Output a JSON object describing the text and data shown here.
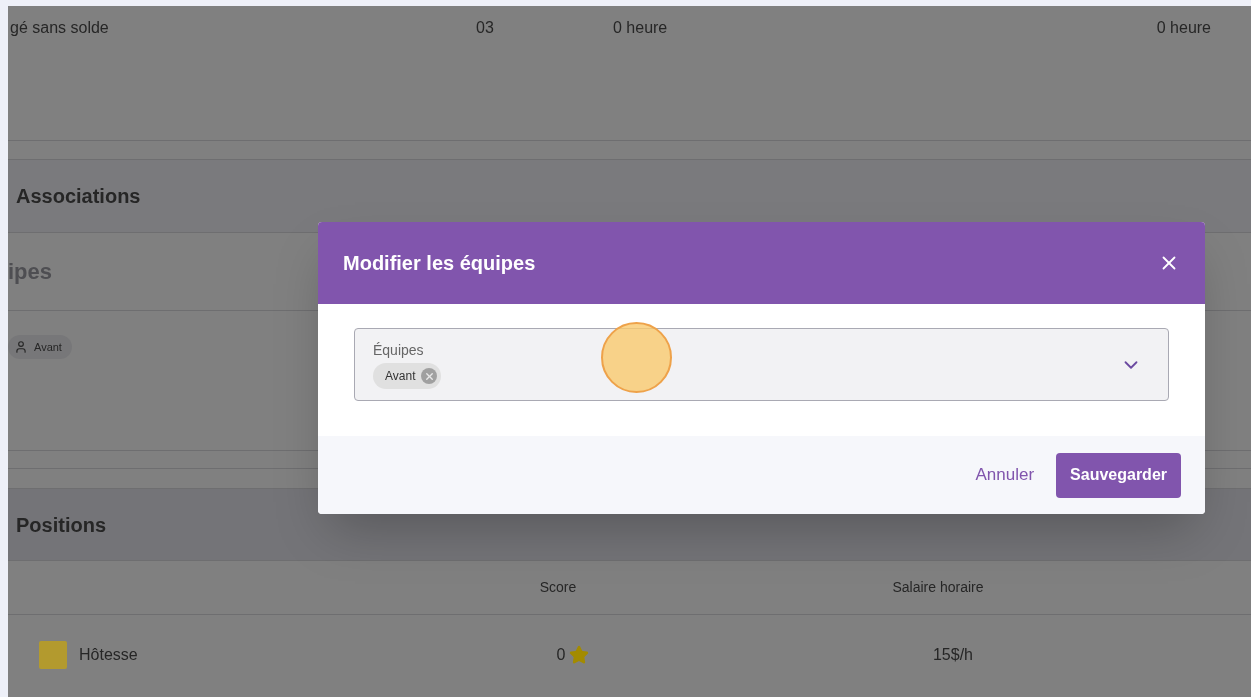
{
  "leave_row": {
    "type": "gé sans solde",
    "code": "03",
    "hours": "0 heure",
    "balance": "0 heure"
  },
  "associations": {
    "title": "Associations",
    "teams_title": "ipes",
    "teams": [
      {
        "label": "Avant"
      }
    ]
  },
  "positions": {
    "title": "Positions",
    "columns": [
      "Score",
      "Salaire horaire"
    ],
    "rows": [
      {
        "name": "Hôtesse",
        "color": "#b39a2e",
        "score": "0",
        "wage": "15$/h"
      }
    ]
  },
  "dialog": {
    "title": "Modifier les équipes",
    "field": {
      "label": "Équipes",
      "chips": [
        "Avant"
      ]
    },
    "buttons": [
      {
        "label": "Annuler",
        "kind": "text"
      },
      {
        "label": "Sauvegarder",
        "kind": "primary"
      }
    ]
  }
}
